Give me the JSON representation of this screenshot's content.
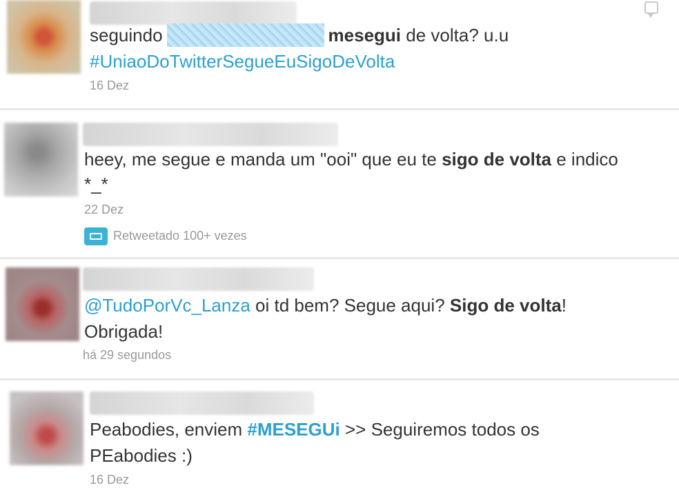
{
  "colors": {
    "link": "#2b9fd4",
    "timestamp": "#999999",
    "divider": "#e8e8e8",
    "retweet_icon": "#3bb3d6"
  },
  "tweets": [
    {
      "text_before": "seguindo",
      "bold": "mesegui",
      "text_after": " de volta? u.u",
      "hashtag": "#UniaoDoTwitterSegueEuSigoDeVolta",
      "time": "16 Dez"
    },
    {
      "text_before": "heey, me segue e manda um \"ooi\" que eu te ",
      "bold": "sigo de volta",
      "text_after": " e indico",
      "line2": "*_*",
      "time": "22 Dez",
      "retweet_label": "Retweetado 100+ vezes"
    },
    {
      "mention": "@TudoPorVc_Lanza",
      "text_before": " oi td bem? Segue aqui? ",
      "bold": "Sigo de volta",
      "text_after": "!",
      "line2": "Obrigada!",
      "time": "há 29 segundos"
    },
    {
      "text_before": "Peabodies, enviem ",
      "hashtag": "#MESEGUi",
      "text_after": " >> Seguiremos todos os",
      "line2": "PEabodies :)",
      "time": "16 Dez"
    }
  ]
}
